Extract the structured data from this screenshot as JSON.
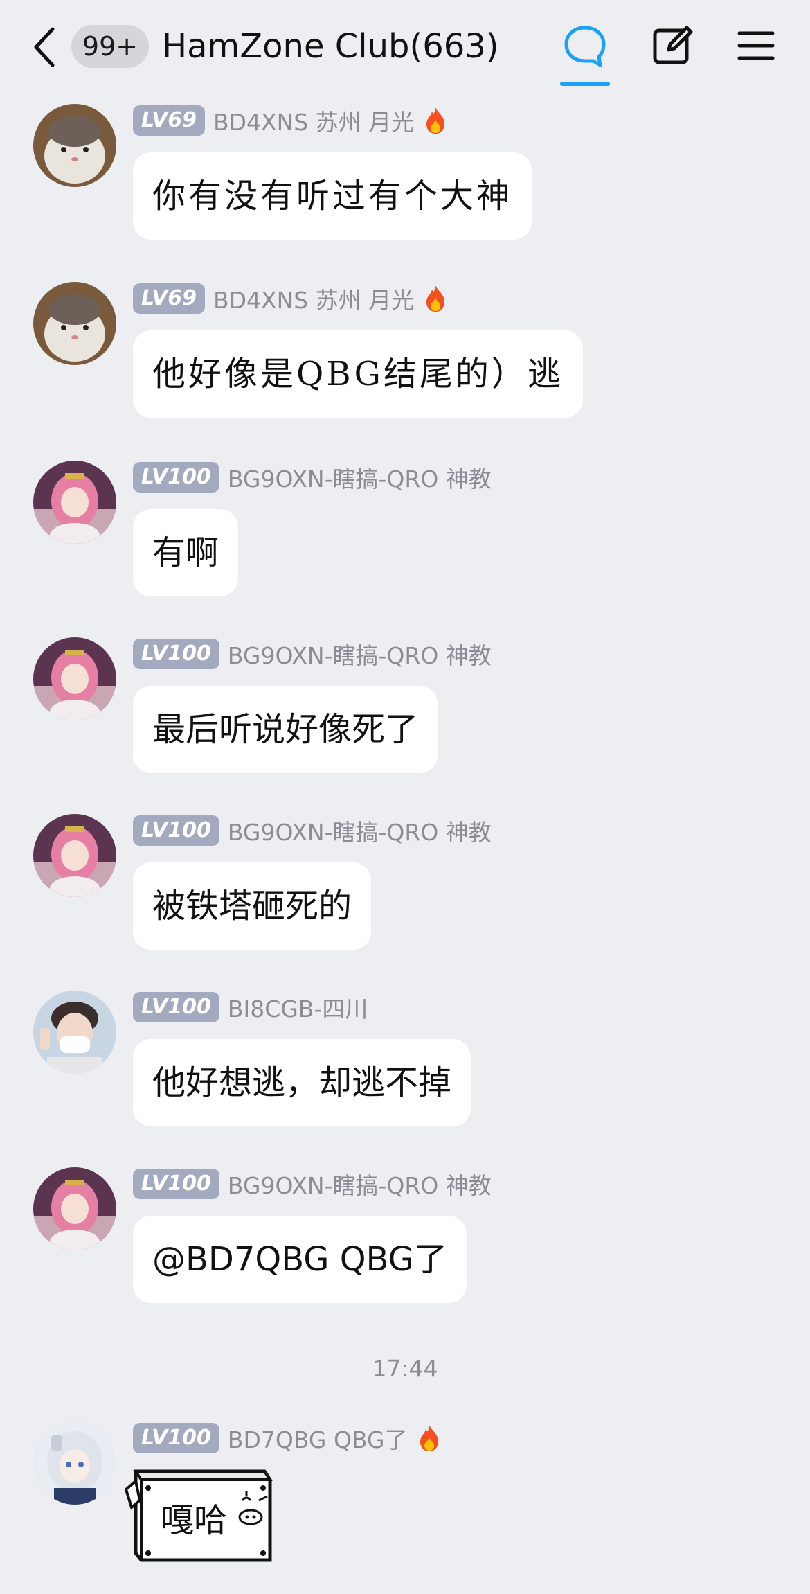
{
  "header": {
    "unread_badge": "99+",
    "title": "HamZone Club(663)",
    "icons": [
      "back-chevron-icon",
      "chat-bubble-icon",
      "compose-icon",
      "menu-icon"
    ],
    "accent_color": "#1ba1f5"
  },
  "messages": [
    {
      "level": "LV69",
      "nick": "BD4XNS 苏州 月光",
      "fire": true,
      "text": "你有没有听过有个大神",
      "avatar": "cat-avatar"
    },
    {
      "level": "LV69",
      "nick": "BD4XNS 苏州 月光",
      "fire": true,
      "text": "他好像是QBG结尾的）逃",
      "avatar": "cat-avatar"
    },
    {
      "level": "LV100",
      "nick": "BG9OXN-瞎搞-QRO 神教",
      "fire": false,
      "text": "有啊",
      "avatar": "anime-girl-avatar"
    },
    {
      "level": "LV100",
      "nick": "BG9OXN-瞎搞-QRO 神教",
      "fire": false,
      "text": "最后听说好像死了",
      "avatar": "anime-girl-avatar"
    },
    {
      "level": "LV100",
      "nick": "BG9OXN-瞎搞-QRO 神教",
      "fire": false,
      "text": "被铁塔砸死的",
      "avatar": "anime-girl-avatar"
    },
    {
      "level": "LV100",
      "nick": "BI8CGB-四川",
      "fire": false,
      "text": "他好想逃，却逃不掉",
      "avatar": "masked-boy-avatar"
    },
    {
      "level": "LV100",
      "nick": "BG9OXN-瞎搞-QRO 神教",
      "fire": false,
      "text": "@BD7QBG QBG了",
      "avatar": "anime-girl-avatar"
    }
  ],
  "timestamp": "17:44",
  "last_message": {
    "level": "LV100",
    "nick": "BD7QBG QBG了",
    "fire": true,
    "sticker_text": "嘎哈",
    "avatar": "white-hair-girl-avatar"
  }
}
